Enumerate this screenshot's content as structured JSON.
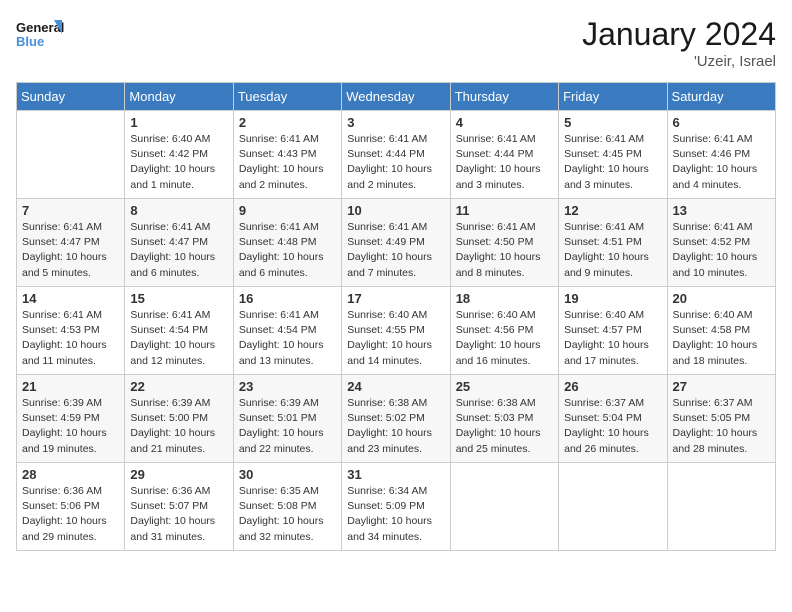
{
  "header": {
    "logo_line1": "General",
    "logo_line2": "Blue",
    "title": "January 2024",
    "subtitle": "'Uzeir, Israel"
  },
  "days_of_week": [
    "Sunday",
    "Monday",
    "Tuesday",
    "Wednesday",
    "Thursday",
    "Friday",
    "Saturday"
  ],
  "weeks": [
    [
      {
        "day": "",
        "info": ""
      },
      {
        "day": "1",
        "info": "Sunrise: 6:40 AM\nSunset: 4:42 PM\nDaylight: 10 hours\nand 1 minute."
      },
      {
        "day": "2",
        "info": "Sunrise: 6:41 AM\nSunset: 4:43 PM\nDaylight: 10 hours\nand 2 minutes."
      },
      {
        "day": "3",
        "info": "Sunrise: 6:41 AM\nSunset: 4:44 PM\nDaylight: 10 hours\nand 2 minutes."
      },
      {
        "day": "4",
        "info": "Sunrise: 6:41 AM\nSunset: 4:44 PM\nDaylight: 10 hours\nand 3 minutes."
      },
      {
        "day": "5",
        "info": "Sunrise: 6:41 AM\nSunset: 4:45 PM\nDaylight: 10 hours\nand 3 minutes."
      },
      {
        "day": "6",
        "info": "Sunrise: 6:41 AM\nSunset: 4:46 PM\nDaylight: 10 hours\nand 4 minutes."
      }
    ],
    [
      {
        "day": "7",
        "info": "Sunrise: 6:41 AM\nSunset: 4:47 PM\nDaylight: 10 hours\nand 5 minutes."
      },
      {
        "day": "8",
        "info": "Sunrise: 6:41 AM\nSunset: 4:47 PM\nDaylight: 10 hours\nand 6 minutes."
      },
      {
        "day": "9",
        "info": "Sunrise: 6:41 AM\nSunset: 4:48 PM\nDaylight: 10 hours\nand 6 minutes."
      },
      {
        "day": "10",
        "info": "Sunrise: 6:41 AM\nSunset: 4:49 PM\nDaylight: 10 hours\nand 7 minutes."
      },
      {
        "day": "11",
        "info": "Sunrise: 6:41 AM\nSunset: 4:50 PM\nDaylight: 10 hours\nand 8 minutes."
      },
      {
        "day": "12",
        "info": "Sunrise: 6:41 AM\nSunset: 4:51 PM\nDaylight: 10 hours\nand 9 minutes."
      },
      {
        "day": "13",
        "info": "Sunrise: 6:41 AM\nSunset: 4:52 PM\nDaylight: 10 hours\nand 10 minutes."
      }
    ],
    [
      {
        "day": "14",
        "info": "Sunrise: 6:41 AM\nSunset: 4:53 PM\nDaylight: 10 hours\nand 11 minutes."
      },
      {
        "day": "15",
        "info": "Sunrise: 6:41 AM\nSunset: 4:54 PM\nDaylight: 10 hours\nand 12 minutes."
      },
      {
        "day": "16",
        "info": "Sunrise: 6:41 AM\nSunset: 4:54 PM\nDaylight: 10 hours\nand 13 minutes."
      },
      {
        "day": "17",
        "info": "Sunrise: 6:40 AM\nSunset: 4:55 PM\nDaylight: 10 hours\nand 14 minutes."
      },
      {
        "day": "18",
        "info": "Sunrise: 6:40 AM\nSunset: 4:56 PM\nDaylight: 10 hours\nand 16 minutes."
      },
      {
        "day": "19",
        "info": "Sunrise: 6:40 AM\nSunset: 4:57 PM\nDaylight: 10 hours\nand 17 minutes."
      },
      {
        "day": "20",
        "info": "Sunrise: 6:40 AM\nSunset: 4:58 PM\nDaylight: 10 hours\nand 18 minutes."
      }
    ],
    [
      {
        "day": "21",
        "info": "Sunrise: 6:39 AM\nSunset: 4:59 PM\nDaylight: 10 hours\nand 19 minutes."
      },
      {
        "day": "22",
        "info": "Sunrise: 6:39 AM\nSunset: 5:00 PM\nDaylight: 10 hours\nand 21 minutes."
      },
      {
        "day": "23",
        "info": "Sunrise: 6:39 AM\nSunset: 5:01 PM\nDaylight: 10 hours\nand 22 minutes."
      },
      {
        "day": "24",
        "info": "Sunrise: 6:38 AM\nSunset: 5:02 PM\nDaylight: 10 hours\nand 23 minutes."
      },
      {
        "day": "25",
        "info": "Sunrise: 6:38 AM\nSunset: 5:03 PM\nDaylight: 10 hours\nand 25 minutes."
      },
      {
        "day": "26",
        "info": "Sunrise: 6:37 AM\nSunset: 5:04 PM\nDaylight: 10 hours\nand 26 minutes."
      },
      {
        "day": "27",
        "info": "Sunrise: 6:37 AM\nSunset: 5:05 PM\nDaylight: 10 hours\nand 28 minutes."
      }
    ],
    [
      {
        "day": "28",
        "info": "Sunrise: 6:36 AM\nSunset: 5:06 PM\nDaylight: 10 hours\nand 29 minutes."
      },
      {
        "day": "29",
        "info": "Sunrise: 6:36 AM\nSunset: 5:07 PM\nDaylight: 10 hours\nand 31 minutes."
      },
      {
        "day": "30",
        "info": "Sunrise: 6:35 AM\nSunset: 5:08 PM\nDaylight: 10 hours\nand 32 minutes."
      },
      {
        "day": "31",
        "info": "Sunrise: 6:34 AM\nSunset: 5:09 PM\nDaylight: 10 hours\nand 34 minutes."
      },
      {
        "day": "",
        "info": ""
      },
      {
        "day": "",
        "info": ""
      },
      {
        "day": "",
        "info": ""
      }
    ]
  ]
}
